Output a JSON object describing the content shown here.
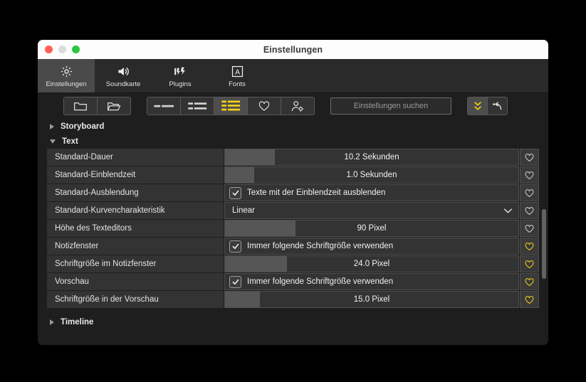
{
  "window": {
    "title": "Einstellungen",
    "traffic_lights": [
      "close-red",
      "minimize-gray",
      "zoom-green"
    ]
  },
  "tabs": [
    {
      "label": "Einstellungen",
      "icon": "gear-icon",
      "active": true
    },
    {
      "label": "Soundkarte",
      "icon": "speaker-icon",
      "active": false
    },
    {
      "label": "Plugins",
      "icon": "plug-lightning-icon",
      "active": false
    },
    {
      "label": "Fonts",
      "icon": "letter-a-box-icon",
      "active": false
    }
  ],
  "toolbar": {
    "file_buttons": [
      {
        "icon": "folder-closed-icon",
        "name": "new-folder-button"
      },
      {
        "icon": "folder-open-icon",
        "name": "open-folder-button"
      }
    ],
    "view_buttons": [
      {
        "icon": "list-compact-icon",
        "active": false
      },
      {
        "icon": "list-medium-icon",
        "active": false
      },
      {
        "icon": "list-large-icon",
        "active": true
      },
      {
        "icon": "heart-icon",
        "active": false
      },
      {
        "icon": "user-settings-icon",
        "active": false
      }
    ],
    "search": {
      "value": "",
      "placeholder": "Einstellungen suchen"
    },
    "right_buttons": [
      {
        "icon": "collapse-chevrons-icon",
        "active": true
      },
      {
        "icon": "undo-arrow-icon",
        "active": false
      }
    ]
  },
  "sections": [
    {
      "label": "Storyboard",
      "expanded": false
    },
    {
      "label": "Text",
      "expanded": true
    },
    {
      "label": "Timeline",
      "expanded": false
    }
  ],
  "rows": [
    {
      "label": "Standard-Dauer",
      "type": "slider",
      "value": "10.2 Sekunden",
      "fill_pct": 17,
      "favorite": false
    },
    {
      "label": "Standard-Einblendzeit",
      "type": "slider",
      "value": "1.0 Sekunden",
      "fill_pct": 10,
      "favorite": false
    },
    {
      "label": "Standard-Ausblendung",
      "type": "checkbox",
      "value": "Texte mit der Einblendzeit ausblenden",
      "checked": true,
      "favorite": false
    },
    {
      "label": "Standard-Kurvencharakteristik",
      "type": "dropdown",
      "value": "Linear",
      "favorite": false
    },
    {
      "label": "Höhe des Texteditors",
      "type": "slider",
      "value": "90 Pixel",
      "fill_pct": 24,
      "favorite": false
    },
    {
      "label": "Notizfenster",
      "type": "checkbox",
      "value": "Immer folgende Schriftgröße verwenden",
      "checked": true,
      "favorite": true
    },
    {
      "label": "Schriftgröße im Notizfenster",
      "type": "slider",
      "value": "24.0 Pixel",
      "fill_pct": 21,
      "favorite": true
    },
    {
      "label": "Vorschau",
      "type": "checkbox",
      "value": "Immer folgende Schriftgröße verwenden",
      "checked": true,
      "favorite": true
    },
    {
      "label": "Schriftgröße in der Vorschau",
      "type": "slider",
      "value": "15.0 Pixel",
      "fill_pct": 12,
      "favorite": true
    }
  ],
  "colors": {
    "accent_yellow": "#f5d312",
    "window_bg": "#1e1e1e",
    "row_bg": "#333333",
    "slider_fill": "#565656",
    "titlebar_bg": "#fdfdfd"
  }
}
